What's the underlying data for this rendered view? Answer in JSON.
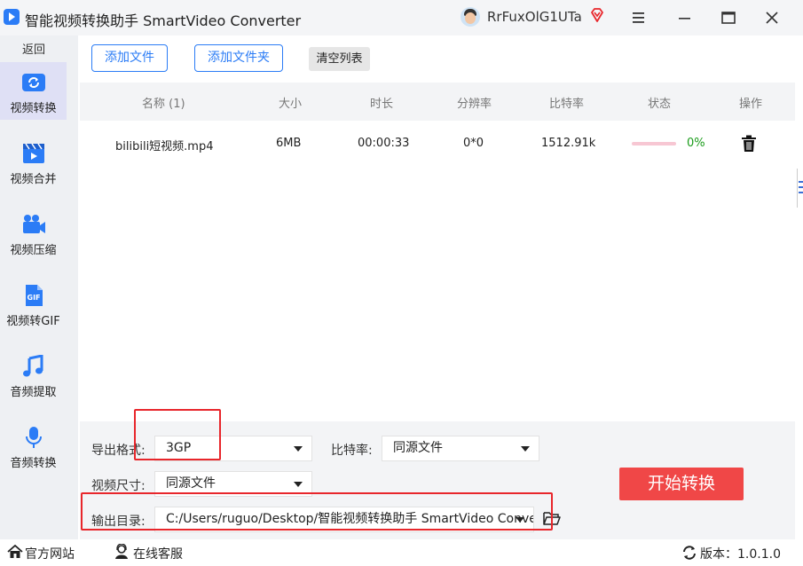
{
  "titlebar": {
    "title": "智能视频转换助手 SmartVideo Converter",
    "username": "RrFuxOlG1UTa",
    "icons": [
      "app-logo-icon",
      "avatar",
      "vip-diamond-icon",
      "menu-icon",
      "minimize-icon",
      "maximize-icon",
      "close-icon"
    ]
  },
  "sidebar": {
    "back": "返回",
    "items": [
      {
        "label": "视频转换",
        "icon": "video-convert-icon",
        "active": true
      },
      {
        "label": "视频合并",
        "icon": "video-merge-icon",
        "active": false
      },
      {
        "label": "视频压缩",
        "icon": "video-compress-icon",
        "active": false
      },
      {
        "label": "视频转GIF",
        "icon": "gif-icon",
        "active": false
      },
      {
        "label": "音频提取",
        "icon": "music-note-icon",
        "active": false
      },
      {
        "label": "音频转换",
        "icon": "microphone-icon",
        "active": false
      }
    ]
  },
  "toolbar": {
    "add_file": "添加文件",
    "add_folder": "添加文件夹",
    "clear_list": "清空列表"
  },
  "table": {
    "headers": [
      "名称 (1)",
      "大小",
      "时长",
      "分辨率",
      "比特率",
      "状态",
      "操作"
    ],
    "rows": [
      {
        "name": "bilibili短视频.mp4",
        "size": "6MB",
        "duration": "00:00:33",
        "resolution": "0*0",
        "bitrate": "1512.91k",
        "progress": 0,
        "status": "0%"
      }
    ]
  },
  "settings": {
    "format_label": "导出格式:",
    "format_value": "3GP",
    "bitrate_label": "比特率:",
    "bitrate_value": "同源文件",
    "size_label": "视频尺寸:",
    "size_value": "同源文件",
    "output_label": "输出目录:",
    "output_value": "C:/Users/ruguo/Desktop/智能视频转换助手 SmartVideo Converter",
    "start_button": "开始转换"
  },
  "footer": {
    "website": "官方网站",
    "support": "在线客服",
    "version": "版本：1.0.1.0"
  },
  "colors": {
    "accent": "#2b7cf6",
    "start_button": "#f04747",
    "progress_track": "#f7c7d3",
    "status_text": "#1a9c1a",
    "annotation_box": "#e8262b",
    "sidebar_active": "#dfe0f5"
  }
}
